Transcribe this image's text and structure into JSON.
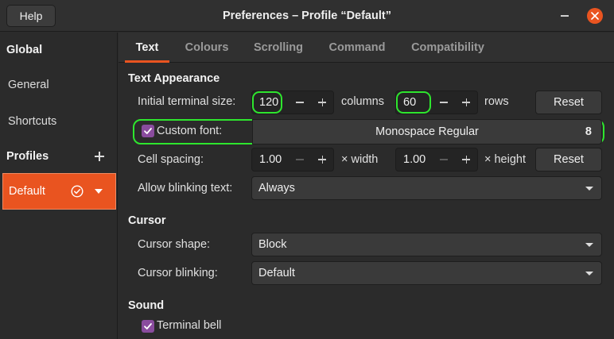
{
  "window": {
    "title": "Preferences – Profile “Default”",
    "help_label": "Help"
  },
  "sidebar": {
    "global_header": "Global",
    "general": "General",
    "shortcuts": "Shortcuts",
    "profiles_header": "Profiles",
    "default_profile": "Default"
  },
  "tabs": [
    "Text",
    "Colours",
    "Scrolling",
    "Command",
    "Compatibility"
  ],
  "text_appearance": {
    "title": "Text Appearance",
    "terminal_size_label": "Initial terminal size:",
    "columns_value": "120",
    "columns_unit": "columns",
    "rows_value": "60",
    "rows_unit": "rows",
    "reset_label": "Reset",
    "custom_font_label": "Custom font:",
    "custom_font_checked": true,
    "font_name": "Monospace Regular",
    "font_size": "8",
    "cell_spacing_label": "Cell spacing:",
    "width_value": "1.00",
    "width_unit": "× width",
    "height_value": "1.00",
    "height_unit": "× height",
    "reset2_label": "Reset",
    "blinking_text_label": "Allow blinking text:",
    "blinking_text_value": "Always"
  },
  "cursor": {
    "title": "Cursor",
    "shape_label": "Cursor shape:",
    "shape_value": "Block",
    "blinking_label": "Cursor blinking:",
    "blinking_value": "Default"
  },
  "sound": {
    "title": "Sound",
    "bell_label": "Terminal bell",
    "bell_checked": true
  },
  "colors": {
    "accent": "#e95420",
    "highlight": "#2ee62e"
  }
}
